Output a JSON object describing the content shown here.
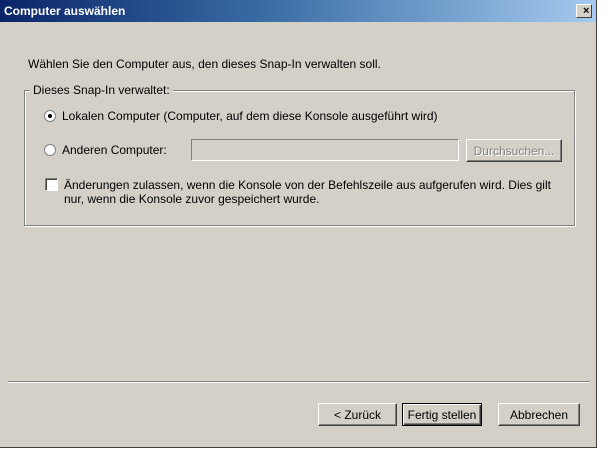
{
  "window": {
    "title": "Computer auswählen",
    "close_glyph": "×"
  },
  "instruction": "Wählen Sie den Computer aus, den dieses Snap-In verwalten soll.",
  "group": {
    "legend": "Dieses Snap-In verwaltet:",
    "options": [
      {
        "label": "Lokalen Computer (Computer, auf dem diese Konsole ausgeführt wird)",
        "selected": true
      },
      {
        "label": "Anderen Computer:",
        "selected": false
      }
    ],
    "other_computer_value": "",
    "browse_label": "Durchsuchen...",
    "checkbox": {
      "checked": false,
      "label": "Änderungen zulassen, wenn die Konsole von der Befehlszeile aus aufgerufen wird. Dies gilt nur, wenn die Konsole zuvor gespeichert wurde."
    }
  },
  "buttons": {
    "back": "< Zurück",
    "finish": "Fertig stellen",
    "cancel": "Abbrechen"
  },
  "colors": {
    "dialog_face": "#d4d0c8",
    "title_start": "#0a246a",
    "title_end": "#a6caf0",
    "disabled_text": "#808080"
  }
}
